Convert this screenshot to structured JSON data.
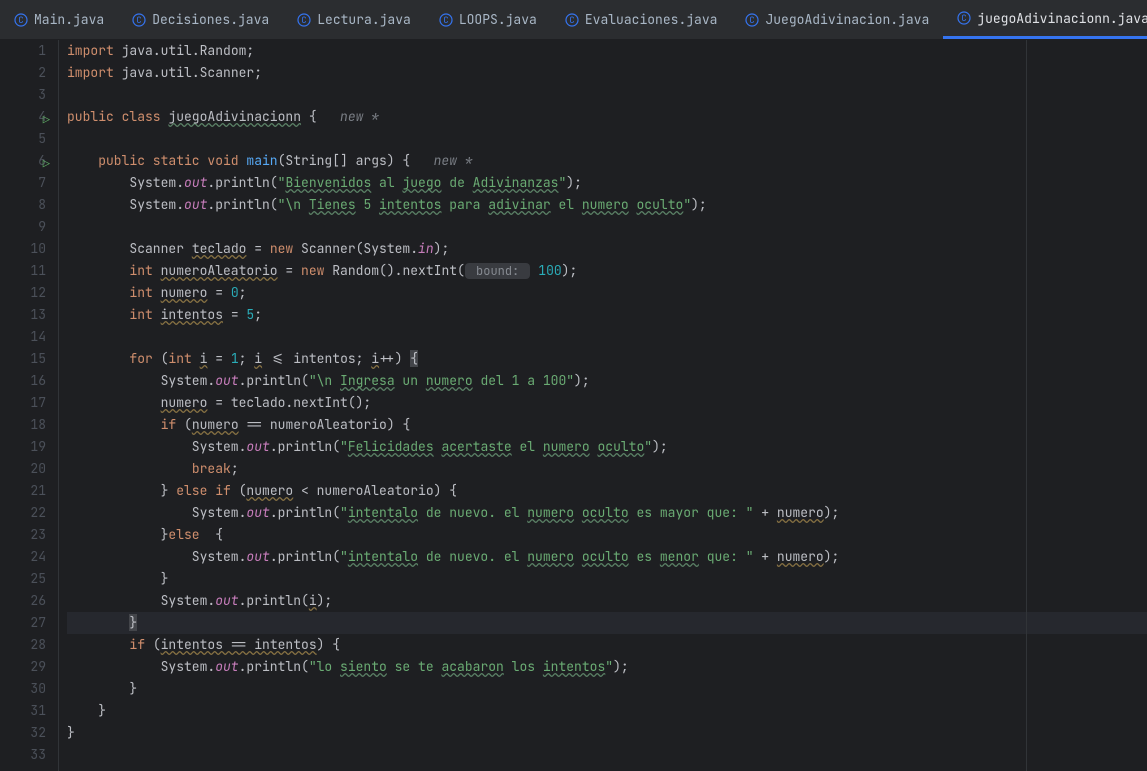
{
  "tabs": [
    {
      "label": "Main.java",
      "active": false
    },
    {
      "label": "Decisiones.java",
      "active": false
    },
    {
      "label": "Lectura.java",
      "active": false
    },
    {
      "label": "LOOPS.java",
      "active": false
    },
    {
      "label": "Evaluaciones.java",
      "active": false
    },
    {
      "label": "JuegoAdivinacion.java",
      "active": false
    },
    {
      "label": "juegoAdivinacionn.java",
      "active": true
    }
  ],
  "lines": [
    "1",
    "2",
    "3",
    "4",
    "5",
    "6",
    "7",
    "8",
    "9",
    "10",
    "11",
    "12",
    "13",
    "14",
    "15",
    "16",
    "17",
    "18",
    "19",
    "20",
    "21",
    "22",
    "23",
    "24",
    "25",
    "26",
    "27",
    "28",
    "29",
    "30",
    "31",
    "32",
    "33"
  ],
  "runLines": [
    4,
    6
  ],
  "highlightLine": 27,
  "code": {
    "l1_import": "import",
    "l1_pkg": " java.util.Random;",
    "l2_import": "import",
    "l2_pkg": " java.util.Scanner;",
    "l4_mods": "public class ",
    "l4_cls": "juegoAdivinacionn",
    "l4_brace": " {",
    "l4_hint": "new *",
    "l6_mods": "public static void ",
    "l6_main": "main",
    "l6_args": "(String[] args) {",
    "l6_hint": "new *",
    "l7_p1": "        System.",
    "l7_out": "out",
    "l7_p2": ".println(",
    "l7_s1": "\"",
    "l7_w1": "Bienvenidos",
    "l7_s2": " al ",
    "l7_w2": "juego",
    "l7_s3": " de ",
    "l7_w3": "Adivinanzas",
    "l7_s4": "\"",
    "l7_p3": ");",
    "l8_p1": "        System.",
    "l8_out": "out",
    "l8_p2": ".println(",
    "l8_s1": "\"\\n ",
    "l8_w1": "Tienes",
    "l8_s2": " 5 ",
    "l8_w2": "intentos",
    "l8_s3": " para ",
    "l8_w3": "adivinar",
    "l8_s4": " el ",
    "l8_w4": "numero",
    "l8_s5": " ",
    "l8_w5": "oculto",
    "l8_s6": "\"",
    "l8_p3": ");",
    "l10_p1": "        Scanner ",
    "l10_w1": "teclado",
    "l10_p2": " = ",
    "l10_new": "new",
    "l10_p3": " Scanner(System.",
    "l10_in": "in",
    "l10_p4": ");",
    "l11_int": "int ",
    "l11_w1": "numeroAleatorio",
    "l11_p1": " = ",
    "l11_new": "new",
    "l11_p2": " Random().nextInt(",
    "l11_hint": " bound: ",
    "l11_num": "100",
    "l11_p3": ");",
    "l12_int": "int ",
    "l12_w1": "numero",
    "l12_p1": " = ",
    "l12_num": "0",
    "l12_p2": ";",
    "l13_int": "int ",
    "l13_w1": "intentos",
    "l13_p1": " = ",
    "l13_num": "5",
    "l13_p2": ";",
    "l15_for": "for ",
    "l15_p0": "(",
    "l15_int": "int ",
    "l15_i1": "i",
    "l15_p1": " = ",
    "l15_n1": "1",
    "l15_p2": "; ",
    "l15_i2": "i",
    "l15_p3": " <= intentos; ",
    "l15_i3": "i",
    "l15_p4": "++) ",
    "l15_brace": "{",
    "l16_p1": "            System.",
    "l16_out": "out",
    "l16_p2": ".println(",
    "l16_s1": "\"\\n ",
    "l16_w1": "Ingresa",
    "l16_s2": " un ",
    "l16_w2": "numero",
    "l16_s3": " del 1 a 100\"",
    "l16_p3": ");",
    "l17_w1": "numero",
    "l17_p1": " = teclado.nextInt();",
    "l18_if": "if ",
    "l18_p0": "(",
    "l18_w1": "numero",
    "l18_p1": " == numeroAleatorio) {",
    "l19_p1": "                System.",
    "l19_out": "out",
    "l19_p2": ".println(",
    "l19_s1": "\"",
    "l19_w1": "Felicidades",
    "l19_s2": " ",
    "l19_w2": "acertaste",
    "l19_s3": " el ",
    "l19_w3": "numero",
    "l19_s4": " ",
    "l19_w4": "oculto",
    "l19_s5": "\"",
    "l19_p3": ");",
    "l20_break": "break",
    "l20_p1": ";",
    "l21_p1": "            } ",
    "l21_else": "else if ",
    "l21_p0": "(",
    "l21_w1": "numero",
    "l21_p2": " < numeroAleatorio) {",
    "l22_p1": "                System.",
    "l22_out": "out",
    "l22_p2": ".println(",
    "l22_s1": "\"",
    "l22_w1": "intentalo",
    "l22_s2": " de nuevo. el ",
    "l22_w2": "numero",
    "l22_s3": " ",
    "l22_w3": "oculto",
    "l22_s4": " es mayor que: \"",
    "l22_p3": " + ",
    "l22_w4": "numero",
    "l22_p4": ");",
    "l23_p1": "            }",
    "l23_else": "else ",
    "l23_p2": " {",
    "l24_p1": "                System.",
    "l24_out": "out",
    "l24_p2": ".println(",
    "l24_s1": "\"",
    "l24_w1": "intentalo",
    "l24_s2": " de nuevo. el ",
    "l24_w2": "numero",
    "l24_s3": " ",
    "l24_w3": "oculto",
    "l24_s4": " es ",
    "l24_w4": "menor",
    "l24_s5": " que: \"",
    "l24_p3": " + ",
    "l24_w5": "numero",
    "l24_p4": ");",
    "l25_p1": "            }",
    "l26_p1": "            System.",
    "l26_out": "out",
    "l26_p2": ".println(",
    "l26_i": "i",
    "l26_p3": ");",
    "l27_brace": "}",
    "l28_if": "if ",
    "l28_p0": "(",
    "l28_w1": "intentos == intentos",
    "l28_p1": ") {",
    "l29_p1": "            System.",
    "l29_out": "out",
    "l29_p2": ".println(",
    "l29_s1": "\"lo ",
    "l29_w1": "siento",
    "l29_s2": " se te ",
    "l29_w2": "acabaron",
    "l29_s3": " los ",
    "l29_w3": "intentos",
    "l29_s4": "\"",
    "l29_p3": ");",
    "l30_p1": "        }",
    "l31_p1": "    }",
    "l32_p1": "}"
  }
}
